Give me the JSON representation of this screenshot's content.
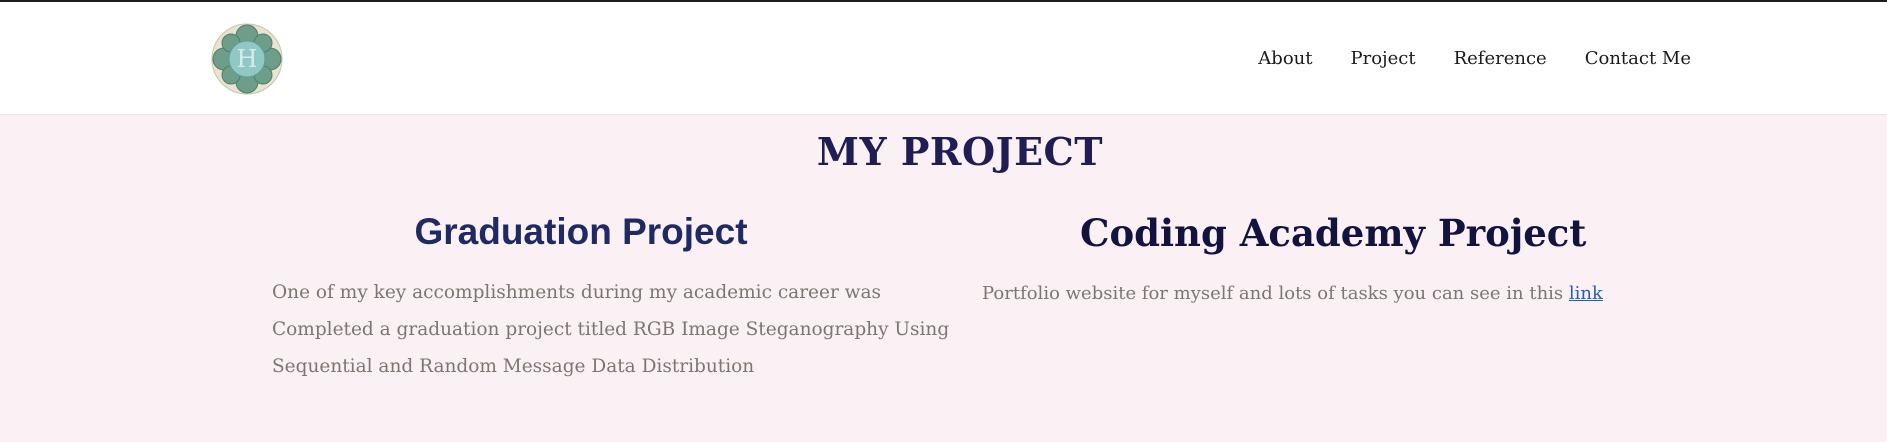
{
  "header": {
    "logo_name": "logo-icon",
    "nav": [
      {
        "label": "About"
      },
      {
        "label": "Project"
      },
      {
        "label": "Reference"
      },
      {
        "label": "Contact Me"
      }
    ]
  },
  "main": {
    "title": "MY PROJECT",
    "projects": [
      {
        "heading": "Graduation Project",
        "description": "One of my key accomplishments during my academic career was Completed a graduation project titled RGB Image Steganography Using Sequential and Random Message Data Distribution"
      },
      {
        "heading": "Coding Academy Project",
        "description": "Portfolio website for myself and lots of tasks you can see in this ",
        "link_text": "link"
      }
    ]
  },
  "colors": {
    "page_bg": "#fbf1f5",
    "title": "#1f1d54",
    "link": "#1f5fb8"
  }
}
